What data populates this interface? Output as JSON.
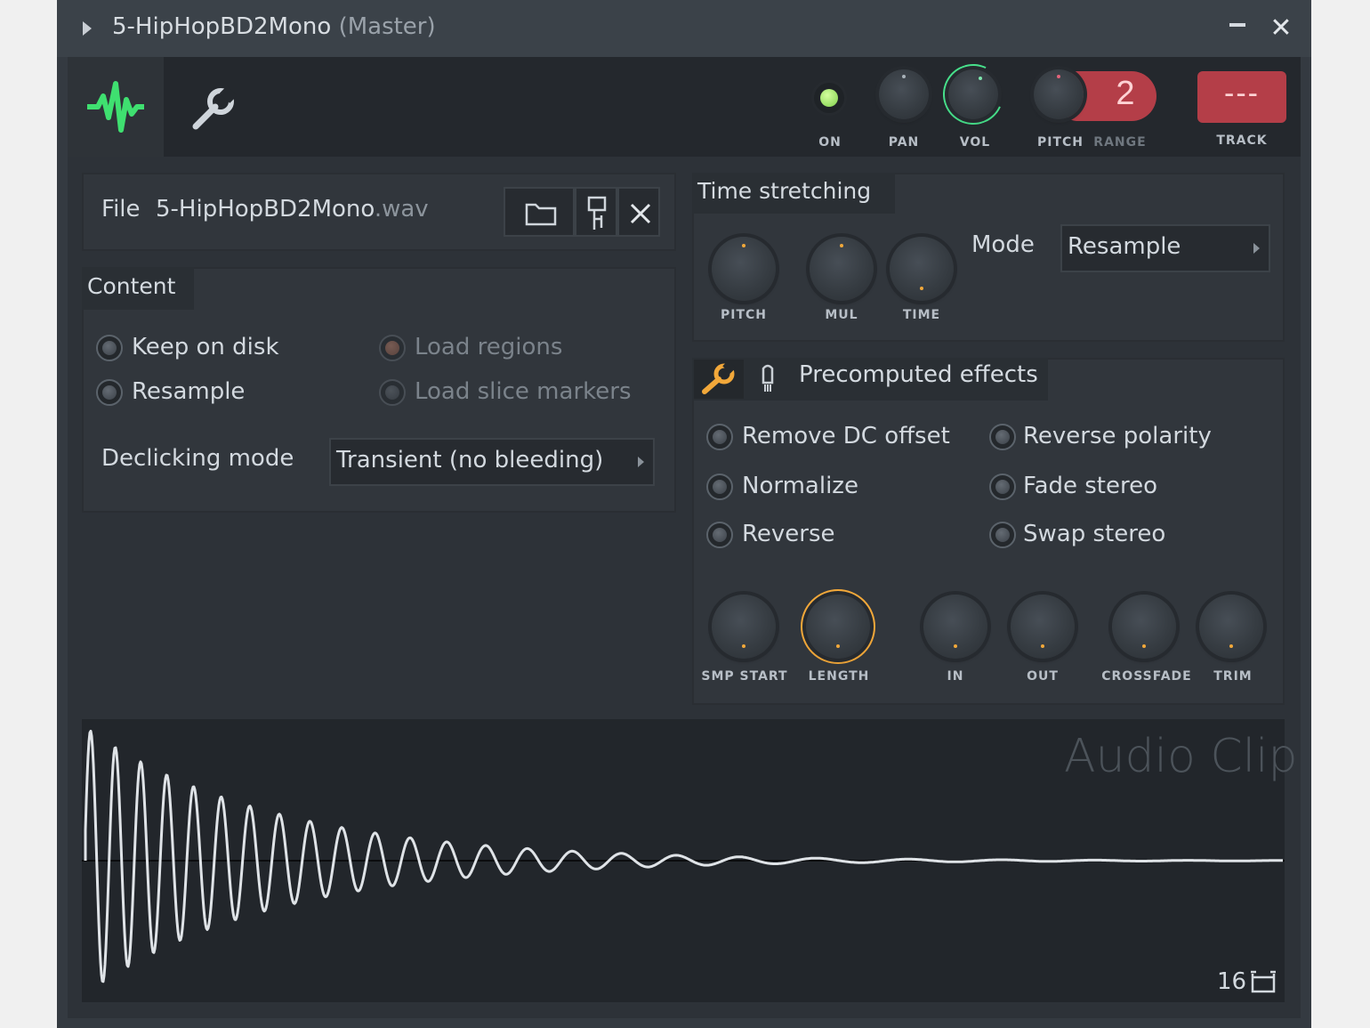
{
  "window": {
    "title": "5-HipHopBD2Mono",
    "title_suffix": "(Master)",
    "minimize_symbol": "–",
    "close_symbol": "✕"
  },
  "toolbar": {
    "tab_waveform_icon": "waveform-icon",
    "tab_settings_icon": "wrench-icon",
    "on_label": "ON",
    "pan_label": "PAN",
    "vol_label": "VOL",
    "pitch_label": "PITCH",
    "range_label": "RANGE",
    "range_value": "2",
    "track_label": "TRACK",
    "track_value": "---",
    "on_color": "#9be36a",
    "vol_color": "#47e08b",
    "range_color": "#c0474f"
  },
  "file": {
    "label": "File",
    "name": "5-HipHopBD2Mono",
    "ext": ".wav"
  },
  "content": {
    "title": "Content",
    "keep_on_disk": "Keep on disk",
    "resample": "Resample",
    "load_regions": "Load regions",
    "load_slice_markers": "Load slice markers",
    "declicking_label": "Declicking mode",
    "declicking_value": "Transient (no bleeding)"
  },
  "time_stretching": {
    "title": "Time stretching",
    "pitch": "PITCH",
    "mul": "MUL",
    "time": "TIME",
    "mode_label": "Mode",
    "mode_value": "Resample"
  },
  "precomputed": {
    "title": "Precomputed effects",
    "remove_dc": "Remove DC offset",
    "normalize": "Normalize",
    "reverse": "Reverse",
    "reverse_polarity": "Reverse polarity",
    "fade_stereo": "Fade stereo",
    "swap_stereo": "Swap stereo",
    "smp_start": "SMP START",
    "length": "LENGTH",
    "in": "IN",
    "out": "OUT",
    "crossfade": "CROSSFADE",
    "trim": "TRIM",
    "accent": "#f2a83a"
  },
  "waveform": {
    "watermark": "Audio Clip",
    "zoom_value": "16"
  }
}
